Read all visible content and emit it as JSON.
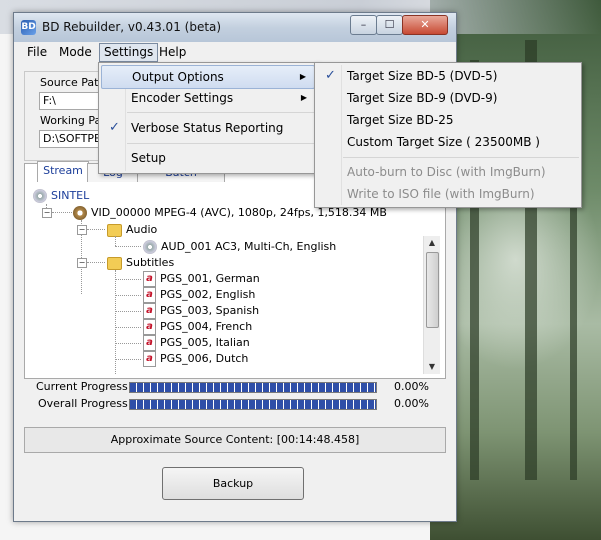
{
  "window": {
    "title": "BD Rebuilder, v0.43.01 (beta)"
  },
  "menubar": {
    "file": "File",
    "mode": "Mode",
    "settings": "Settings",
    "help": "Help"
  },
  "source": {
    "path_label": "Source Path",
    "path_value": "F:\\",
    "working_label": "Working Pat",
    "working_value": "D:\\SOFTPED"
  },
  "tabs": {
    "stream": "Stream",
    "log": "Log",
    "batch": "Batch"
  },
  "tree": {
    "root": "SINTEL",
    "video": "VID_00000  MPEG-4 (AVC), 1080p, 24fps, 1,518.34 MB",
    "audio_folder": "Audio",
    "audio_track": "AUD_001 AC3, Multi-Ch, English",
    "subtitles_folder": "Subtitles",
    "subs": [
      "PGS_001, German",
      "PGS_002, English",
      "PGS_003, Spanish",
      "PGS_004, French",
      "PGS_005, Italian",
      "PGS_006, Dutch"
    ]
  },
  "progress": {
    "current_label": "Current Progress:",
    "current_value": "0.00%",
    "overall_label": "Overall Progress:",
    "overall_value": "0.00%"
  },
  "approx": "Approximate Source Content: [00:14:48.458]",
  "backup_label": "Backup",
  "settings_menu": {
    "output_options": "Output Options",
    "encoder_settings": "Encoder Settings",
    "verbose": "Verbose Status Reporting",
    "setup": "Setup"
  },
  "output_menu": {
    "bd5": "Target Size BD-5 (DVD-5)",
    "bd9": "Target Size BD-9 (DVD-9)",
    "bd25": "Target Size BD-25",
    "custom": "Custom Target Size ( 23500MB )",
    "autoburn": "Auto-burn to Disc (with ImgBurn)",
    "iso": "Write to ISO file (with ImgBurn)"
  }
}
